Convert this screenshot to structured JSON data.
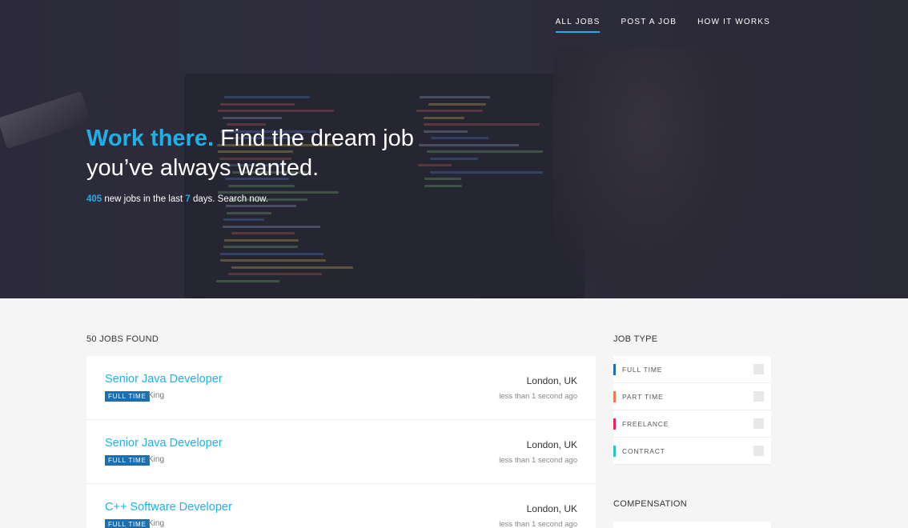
{
  "nav": {
    "items": [
      {
        "label": "ALL JOBS",
        "active": true
      },
      {
        "label": "POST A JOB",
        "active": false
      },
      {
        "label": "HOW IT WORKS",
        "active": false
      }
    ]
  },
  "hero": {
    "headline_accent": "Work there.",
    "headline_rest": " Find the dream job you’ve always wanted.",
    "sub_count": "405",
    "sub_mid": " new jobs in the last ",
    "sub_days": "7",
    "sub_end": " days. Search now."
  },
  "listing": {
    "found_label": "50 JOBS FOUND",
    "jobs": [
      {
        "title": "Senior Java Developer",
        "type": "FULL TIME",
        "company": "King",
        "location": "London, UK",
        "posted": "less than 1 second ago"
      },
      {
        "title": "Senior Java Developer",
        "type": "FULL TIME",
        "company": "King",
        "location": "London, UK",
        "posted": "less than 1 second ago"
      },
      {
        "title": "C++ Software Developer",
        "type": "FULL TIME",
        "company": "King",
        "location": "London, UK",
        "posted": "less than 1 second ago"
      }
    ]
  },
  "sidebar": {
    "job_type_title": "JOB TYPE",
    "types": [
      {
        "label": "FULL TIME",
        "color": "#1b6fae"
      },
      {
        "label": "PART TIME",
        "color": "#f0774e"
      },
      {
        "label": "FREELANCE",
        "color": "#e8245a"
      },
      {
        "label": "CONTRACT",
        "color": "#2fc2bd"
      }
    ],
    "compensation_title": "COMPENSATION"
  },
  "colors": {
    "accent": "#1fb0e8",
    "badge": "#1b6fae"
  }
}
